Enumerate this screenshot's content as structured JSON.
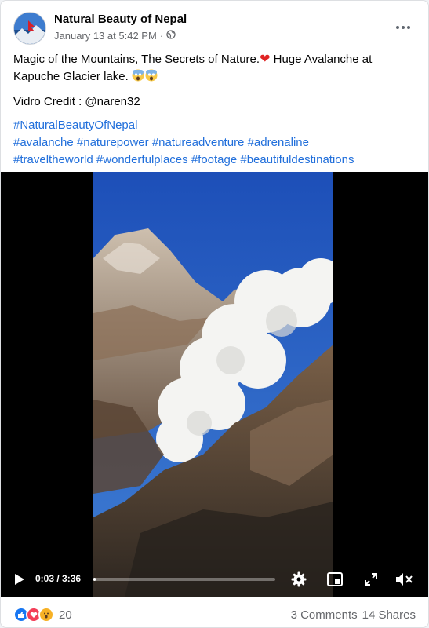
{
  "post": {
    "page_name": "Natural Beauty of Nepal",
    "timestamp": "January 13 at 5:42 PM",
    "separator": "·",
    "privacy": "globe-icon",
    "text_line1_a": "Magic of the Mountains, The Secrets of Nature.",
    "text_line1_b": " Huge Avalanche at Kapuche Glacier lake.",
    "credit": "Vidro Credit : @naren32",
    "hashtag_main": "#NaturalBeautyOfNepal",
    "hashtags": [
      "#avalanche",
      "#naturepower",
      "#natureadventure",
      "#adrenaline",
      "#traveltheworld",
      "#wonderfulplaces",
      "#footage",
      "#beautifuldestinations"
    ]
  },
  "video": {
    "current_time": "0:03",
    "duration": "3:36",
    "time_display": "0:03 / 3:36",
    "progress_fraction": 0.014
  },
  "footer": {
    "reaction_count": "20",
    "comments": "3 Comments",
    "shares": "14 Shares",
    "reactions": [
      "like",
      "love",
      "wow"
    ]
  },
  "colors": {
    "link": "#216fdb",
    "like": "#1877f2",
    "love": "#f33e58",
    "wow": "#f7b125"
  }
}
